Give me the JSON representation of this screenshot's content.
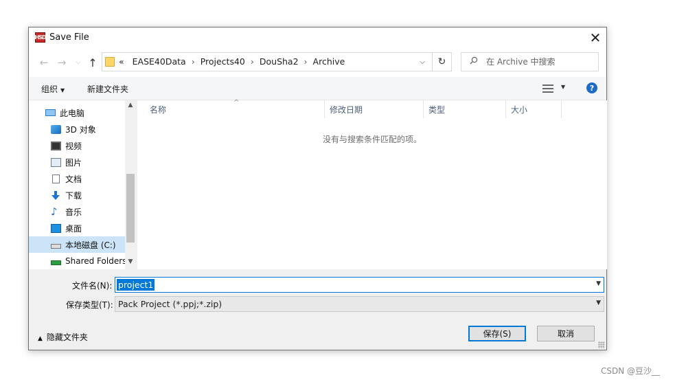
{
  "window": {
    "title": "Save File",
    "app_icon_text": "HSD",
    "close_label": "✕"
  },
  "nav": {
    "back": "←",
    "forward": "→",
    "recent": "⌵",
    "up": "↑",
    "breadcrumb_overflow": "«",
    "breadcrumbs": [
      "EASE40Data",
      "Projects40",
      "DouSha2",
      "Archive"
    ],
    "separator": "›",
    "address_dropdown": "⌵",
    "refresh": "↻",
    "search_placeholder": "在 Archive 中搜索"
  },
  "toolbar": {
    "organize": "组织",
    "new_folder": "新建文件夹",
    "help": "?"
  },
  "sidebar": {
    "items": [
      {
        "label": "此电脑",
        "icon": "computer-icon"
      },
      {
        "label": "3D 对象",
        "icon": "3d-objects-icon"
      },
      {
        "label": "视频",
        "icon": "video-icon"
      },
      {
        "label": "图片",
        "icon": "pictures-icon"
      },
      {
        "label": "文档",
        "icon": "documents-icon"
      },
      {
        "label": "下载",
        "icon": "downloads-icon"
      },
      {
        "label": "音乐",
        "icon": "music-icon"
      },
      {
        "label": "桌面",
        "icon": "desktop-icon"
      },
      {
        "label": "本地磁盘 (C:)",
        "icon": "drive-icon",
        "selected": true
      },
      {
        "label": "Shared Folders",
        "icon": "network-drive-icon"
      }
    ]
  },
  "file_list": {
    "columns": [
      "名称",
      "修改日期",
      "类型",
      "大小"
    ],
    "empty_message": "没有与搜索条件匹配的项。"
  },
  "form": {
    "filename_label": "文件名(N):",
    "filename_value": "project1",
    "filetype_label": "保存类型(T):",
    "filetype_value": "Pack Project (*.ppj;*.zip)"
  },
  "footer": {
    "hide_folders": "隐藏文件夹",
    "save_button": "保存(S)",
    "cancel_button": "取消"
  },
  "watermark": "CSDN @豆沙__",
  "colors": {
    "accent": "#0078d7",
    "selection": "#cce4f7"
  }
}
